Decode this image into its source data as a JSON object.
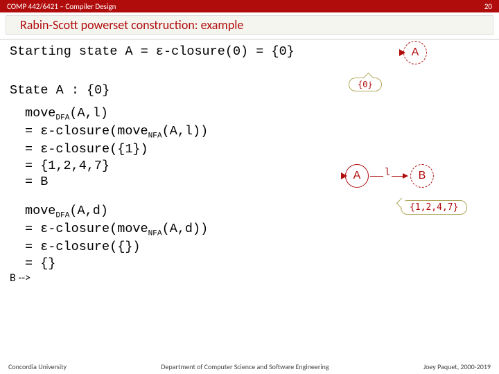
{
  "header": {
    "course": "COMP 442/6421 – Compiler Design",
    "page": "20"
  },
  "title": "Rabin-Scott powerset construction: example",
  "body": {
    "line1": "Starting state A = ε-closure(0) = {0}",
    "line2": "State A : {0}",
    "moveL_head": "(A,l)",
    "moveL_l2": "= ε-closure(move",
    "moveL_l2b": "(A,l))",
    "moveL_l3": "= ε-closure({1})",
    "moveL_l4": "= {1,2,4,7}",
    "moveL_l5": "= B",
    "moveD_head": "(A,d)",
    "moveD_l2": "= ε-closure(move",
    "moveD_l2b": "(A,d))",
    "moveD_l3": "= ε-closure({})",
    "moveD_l4": "= {}",
    "sub_dfa": "DFA",
    "sub_nfa": "NFA",
    "prefix_move": "move"
  },
  "diagram": {
    "top_state": "A",
    "top_callout": "{0}",
    "stateA": "A",
    "stateB": "B",
    "edge_label": "l",
    "callout_b": "{1,2,4,7}"
  },
  "footer": {
    "left": "Concordia University",
    "center": "Department of Computer Science and Software Engineering",
    "right": "Joey Paquet, 2000-2019"
  }
}
